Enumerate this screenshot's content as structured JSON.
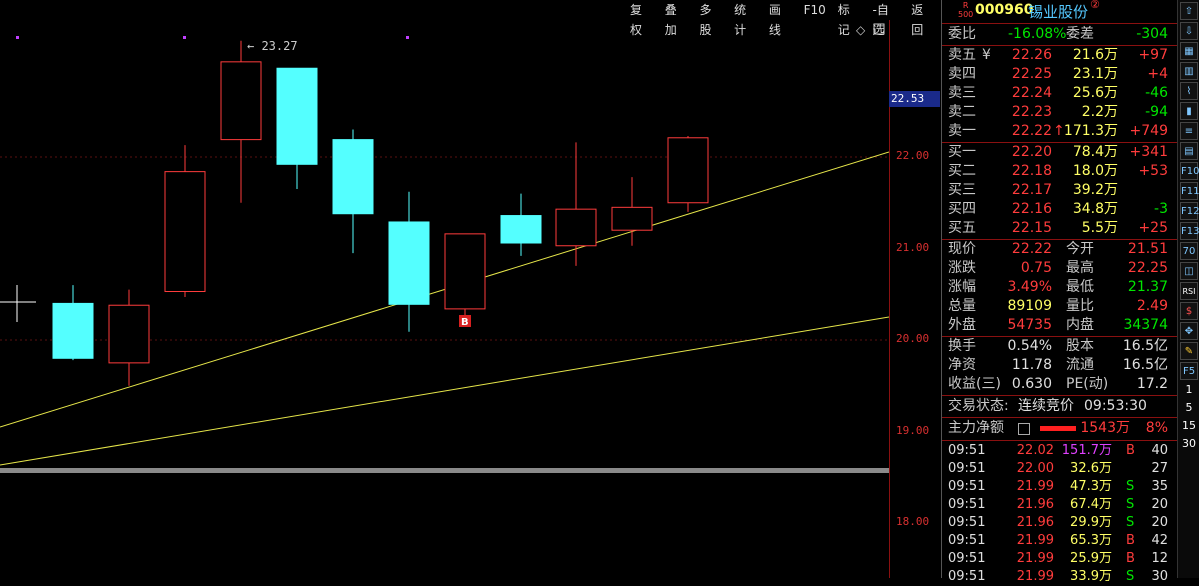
{
  "toolbar": {
    "buttons": [
      "复权",
      "叠加",
      "多股",
      "统计",
      "画线",
      "F10",
      "标记",
      "-自选",
      "返回"
    ]
  },
  "chart": {
    "high_label": "23.27",
    "current_price": "22.53",
    "ticks": [
      "22.00",
      "21.00",
      "20.00",
      "19.00",
      "18.00"
    ],
    "buy_marker": "B",
    "candles": [
      {
        "o": 20.3,
        "c": 20.3,
        "h": 20.3,
        "l": 20.3
      },
      {
        "o": 20.4,
        "c": 19.8,
        "h": 20.6,
        "l": 19.78,
        "up": false
      },
      {
        "o": 19.75,
        "c": 20.38,
        "h": 20.55,
        "l": 19.5,
        "up": true
      },
      {
        "o": 20.53,
        "c": 21.84,
        "h": 22.13,
        "l": 20.47,
        "up": true
      },
      {
        "o": 22.19,
        "c": 23.04,
        "h": 23.27,
        "l": 21.5,
        "up": true
      },
      {
        "o": 22.97,
        "c": 21.92,
        "h": 22.97,
        "l": 21.65,
        "up": false
      },
      {
        "o": 22.19,
        "c": 21.38,
        "h": 22.3,
        "l": 20.95,
        "up": false
      },
      {
        "o": 21.29,
        "c": 20.39,
        "h": 21.62,
        "l": 20.09,
        "up": false
      },
      {
        "o": 20.34,
        "c": 21.16,
        "h": 21.16,
        "l": 20.2,
        "up": true
      },
      {
        "o": 21.06,
        "c": 21.36,
        "h": 21.6,
        "l": 20.92,
        "up": false
      },
      {
        "o": 21.03,
        "c": 21.43,
        "h": 22.16,
        "l": 20.81,
        "up": true
      },
      {
        "o": 21.2,
        "c": 21.45,
        "h": 21.78,
        "l": 21.03,
        "up": true
      },
      {
        "o": 21.5,
        "c": 22.21,
        "h": 22.23,
        "l": 21.4,
        "up": true
      }
    ]
  },
  "stock": {
    "badge_top": "R",
    "badge_bottom": "500",
    "code": "000960",
    "name": "锡业股份",
    "mark": "②"
  },
  "webi": {
    "label1": "委比",
    "value1": "-16.08%",
    "label2": "委差",
    "value2": "-304"
  },
  "sell": [
    {
      "label": "卖五",
      "flag": "¥",
      "price": "22.26",
      "vol": "21.6万",
      "chg": "+97"
    },
    {
      "label": "卖四",
      "price": "22.25",
      "vol": "23.1万",
      "chg": "+4"
    },
    {
      "label": "卖三",
      "price": "22.24",
      "vol": "25.6万",
      "chg": "-46"
    },
    {
      "label": "卖二",
      "price": "22.23",
      "vol": "2.2万",
      "chg": "-94"
    },
    {
      "label": "卖一",
      "price": "22.22",
      "arrow": "↑",
      "vol": "171.3万",
      "chg": "+749"
    }
  ],
  "buy": [
    {
      "label": "买一",
      "price": "22.20",
      "vol": "78.4万",
      "chg": "+341"
    },
    {
      "label": "买二",
      "price": "22.18",
      "vol": "18.0万",
      "chg": "+53"
    },
    {
      "label": "买三",
      "price": "22.17",
      "vol": "39.2万",
      "chg": ""
    },
    {
      "label": "买四",
      "price": "22.16",
      "vol": "34.8万",
      "chg": "-3"
    },
    {
      "label": "买五",
      "price": "22.15",
      "vol": "5.5万",
      "chg": "+25"
    }
  ],
  "stats": [
    {
      "l1": "现价",
      "v1": "22.22",
      "l2": "今开",
      "v2": "21.51"
    },
    {
      "l1": "涨跌",
      "v1": "0.75",
      "l2": "最高",
      "v2": "22.25"
    },
    {
      "l1": "涨幅",
      "v1": "3.49%",
      "l2": "最低",
      "v2": "21.37"
    },
    {
      "l1": "总量",
      "v1": "89109",
      "l2": "量比",
      "v2": "2.49"
    },
    {
      "l1": "外盘",
      "v1": "54735",
      "l2": "内盘",
      "v2": "34374"
    }
  ],
  "stats2": [
    {
      "l1": "换手",
      "v1": "0.54%",
      "l2": "股本",
      "v2": "16.5亿"
    },
    {
      "l1": "净资",
      "v1": "11.78",
      "l2": "流通",
      "v2": "16.5亿"
    },
    {
      "l1": "收益(三)",
      "v1": "0.630",
      "l2": "PE(动)",
      "v2": "17.2"
    }
  ],
  "status": {
    "label": "交易状态:",
    "value": "连续竞价",
    "time": "09:53:30"
  },
  "main_flow": {
    "label": "主力净额",
    "value": "1543万",
    "pct": "8%"
  },
  "trades": [
    {
      "t": "09:51",
      "p": "22.02",
      "v": "151.7万",
      "s": "B",
      "n": "40"
    },
    {
      "t": "09:51",
      "p": "22.00",
      "v": "32.6万",
      "s": "",
      "n": "27"
    },
    {
      "t": "09:51",
      "p": "21.99",
      "v": "47.3万",
      "s": "S",
      "n": "35"
    },
    {
      "t": "09:51",
      "p": "21.96",
      "v": "67.4万",
      "s": "S",
      "n": "20"
    },
    {
      "t": "09:51",
      "p": "21.96",
      "v": "29.9万",
      "s": "S",
      "n": "20"
    },
    {
      "t": "09:51",
      "p": "21.99",
      "v": "65.3万",
      "s": "B",
      "n": "42"
    },
    {
      "t": "09:51",
      "p": "21.99",
      "v": "25.9万",
      "s": "B",
      "n": "12"
    },
    {
      "t": "09:51",
      "p": "21.99",
      "v": "33.9万",
      "s": "S",
      "n": "30"
    }
  ],
  "sidebar": {
    "icons": [
      "up-arrow",
      "down-arrow",
      "grid",
      "bar",
      "line",
      "candle",
      "list",
      "table",
      "f10",
      "f11",
      "f12",
      "f13",
      "f14",
      "chart",
      "rsi",
      "dollar",
      "move",
      "pen"
    ],
    "labels": [
      "RSI",
      "F5"
    ],
    "numbers": [
      "1",
      "5",
      "15",
      "30"
    ]
  }
}
